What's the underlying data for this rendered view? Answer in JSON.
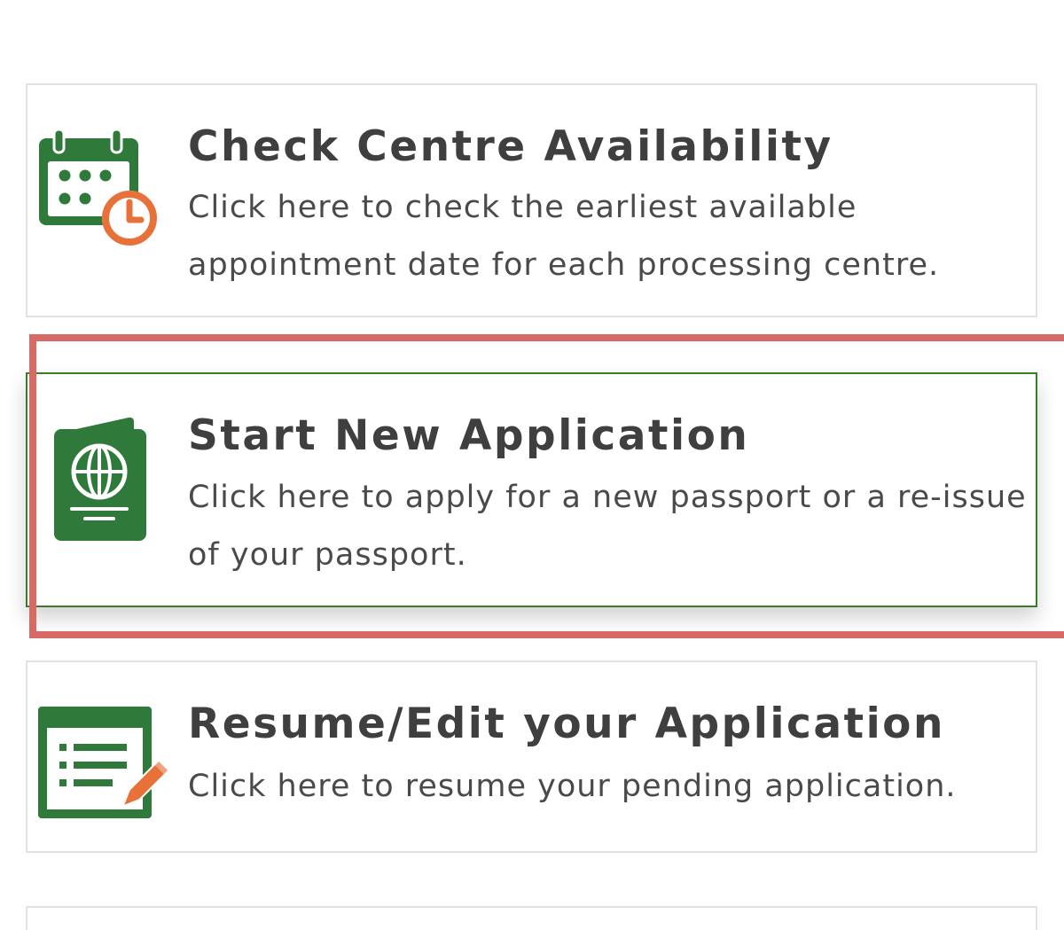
{
  "cards": [
    {
      "title": "Check Centre Availability",
      "description_lines": [
        "Click here to check the earliest available",
        "appointment date for each processing centre."
      ],
      "icon": "calendar-clock-icon"
    },
    {
      "title": "Start New Application",
      "description_lines": [
        "Click here to apply for a new passport or a re-issue",
        "of your passport."
      ],
      "icon": "passport-icon"
    },
    {
      "title": "Resume/Edit your Application",
      "description_lines": [
        "Click here to resume your pending application."
      ],
      "icon": "form-edit-icon"
    }
  ],
  "colors": {
    "icon_green": "#2f7a3a",
    "icon_orange": "#e8713a",
    "highlight_red": "#d86a66",
    "selected_border": "#3b7a28"
  }
}
